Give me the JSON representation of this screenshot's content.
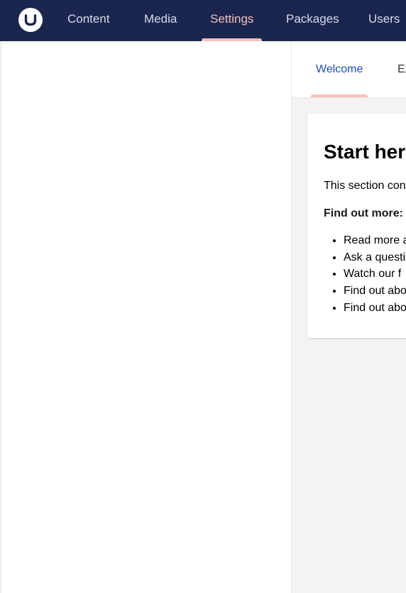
{
  "header": {
    "logo": "umbraco-logo",
    "nav": [
      {
        "label": "Content",
        "active": false
      },
      {
        "label": "Media",
        "active": false
      },
      {
        "label": "Settings",
        "active": true
      },
      {
        "label": "Packages",
        "active": false
      },
      {
        "label": "Users",
        "active": false
      }
    ],
    "colors": {
      "bar": "#1b264f",
      "active": "#f5c1bc"
    }
  },
  "tabs": [
    {
      "label": "Welcome",
      "active": true
    },
    {
      "label": "Ex",
      "active": false
    }
  ],
  "card": {
    "title": "Start here",
    "intro": "This section con",
    "find_out_more": "Find out more:",
    "links": [
      "Read more a",
      "Ask a questi",
      "Watch our f",
      "Find out abo",
      "Find out abo"
    ]
  }
}
